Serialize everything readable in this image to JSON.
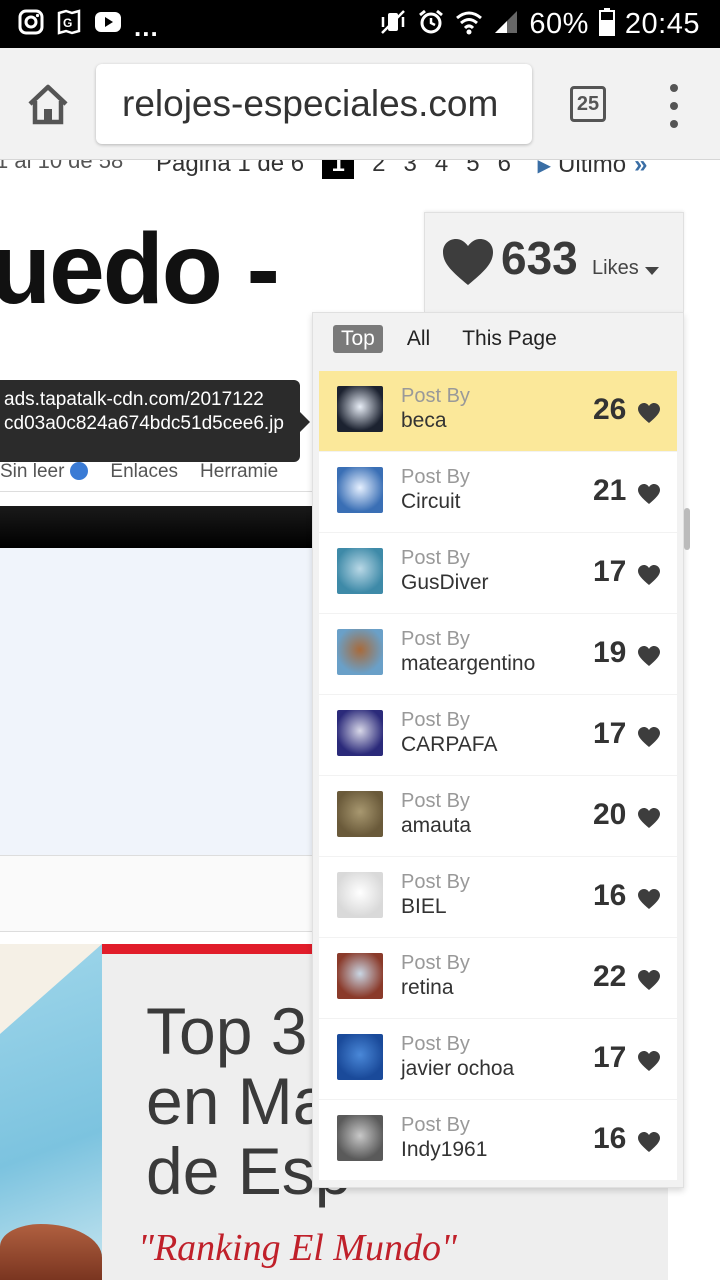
{
  "status_bar": {
    "battery": "60%",
    "time": "20:45",
    "more": "...",
    "left_icons": [
      "instagram-icon",
      "maps-icon",
      "youtube-icon"
    ],
    "right_icons": [
      "vibrate-icon",
      "alarm-icon",
      "wifi-icon",
      "signal-icon",
      "battery-icon"
    ]
  },
  "browser": {
    "url": "relojes-especiales.com",
    "tab_count": "25",
    "icons": [
      "home-icon",
      "menu-icon"
    ]
  },
  "page": {
    "pager_summary": "1 al 10 de 58",
    "pager_label": "Página 1 de 6",
    "pager_current": "1",
    "pager_pages": [
      "2",
      "3",
      "4",
      "5",
      "6"
    ],
    "pager_last": "Último",
    "title": "uedo -",
    "tooltip_line1": "ads.tapatalk-cdn.com/2017122",
    "tooltip_line2": "cd03a0c824a674bdc51d5cee6.jp",
    "nav_unread": "Sin leer",
    "nav_links": "Enlaces",
    "nav_tools": "Herramie",
    "ad_title": "Top 3 M\nen Ma\nde Esp",
    "ad_subtitle": "\"Ranking El Mundo\""
  },
  "likes_widget": {
    "count": "633",
    "label": "Likes",
    "tabs": [
      {
        "label": "Top",
        "active": true
      },
      {
        "label": "All",
        "active": false
      },
      {
        "label": "This Page",
        "active": false
      }
    ],
    "post_by_label": "Post By",
    "rows": [
      {
        "user": "beca",
        "count": "26",
        "highlight": true,
        "avatar_color": "#1c2230",
        "avatar_accent": "#e8eef7"
      },
      {
        "user": "Circuit",
        "count": "21",
        "highlight": false,
        "avatar_color": "#3a6fb5",
        "avatar_accent": "#e6f0ff"
      },
      {
        "user": "GusDiver",
        "count": "17",
        "highlight": false,
        "avatar_color": "#3e8aa8",
        "avatar_accent": "#b9d8e6"
      },
      {
        "user": "mateargentino",
        "count": "19",
        "highlight": false,
        "avatar_color": "#6aa0c8",
        "avatar_accent": "#a86a3a"
      },
      {
        "user": "CARPAFA",
        "count": "17",
        "highlight": false,
        "avatar_color": "#2b2a7a",
        "avatar_accent": "#d8d8e8"
      },
      {
        "user": "amauta",
        "count": "20",
        "highlight": false,
        "avatar_color": "#6a5a3a",
        "avatar_accent": "#a89870"
      },
      {
        "user": "BIEL",
        "count": "16",
        "highlight": false,
        "avatar_color": "#d9d9d9",
        "avatar_accent": "#ffffff"
      },
      {
        "user": "retina",
        "count": "22",
        "highlight": false,
        "avatar_color": "#8a3a2a",
        "avatar_accent": "#c9d6e4"
      },
      {
        "user": "javier ochoa",
        "count": "17",
        "highlight": false,
        "avatar_color": "#1a4a9a",
        "avatar_accent": "#4a88d8"
      },
      {
        "user": "Indy1961",
        "count": "16",
        "highlight": false,
        "avatar_color": "#5a5a5a",
        "avatar_accent": "#c8c8c8"
      }
    ]
  }
}
